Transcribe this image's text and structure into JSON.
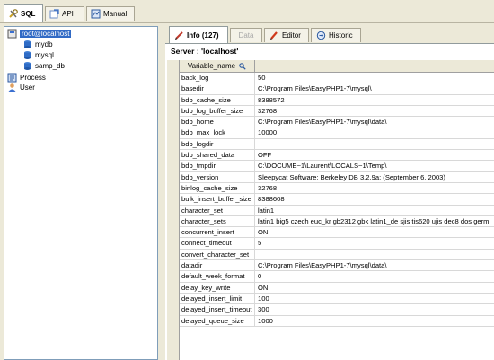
{
  "top_tabs": [
    {
      "label": "SQL",
      "icon": "sql-wrench-icon",
      "active": true
    },
    {
      "label": "API",
      "icon": "api-icon",
      "active": false
    },
    {
      "label": "Manual",
      "icon": "manual-icon",
      "active": false
    }
  ],
  "tree": {
    "root": "root@localhost",
    "databases": [
      "mydb",
      "mysql",
      "samp_db"
    ],
    "process": "Process",
    "user": "User"
  },
  "right_tabs": [
    {
      "label": "Info (127)",
      "icon": "info-icon",
      "state": "active"
    },
    {
      "label": "Data",
      "icon": "",
      "state": "disabled"
    },
    {
      "label": "Editor",
      "icon": "pencil-icon",
      "state": "normal"
    },
    {
      "label": "Historic",
      "icon": "historic-icon",
      "state": "normal"
    }
  ],
  "server_label": "Server : 'localhost'",
  "grid": {
    "column_header": "Variable_name",
    "rows": [
      {
        "name": "back_log",
        "value": "50"
      },
      {
        "name": "basedir",
        "value": "C:\\Program Files\\EasyPHP1-7\\mysql\\"
      },
      {
        "name": "bdb_cache_size",
        "value": "8388572"
      },
      {
        "name": "bdb_log_buffer_size",
        "value": "32768"
      },
      {
        "name": "bdb_home",
        "value": "C:\\Program Files\\EasyPHP1-7\\mysql\\data\\"
      },
      {
        "name": "bdb_max_lock",
        "value": "10000"
      },
      {
        "name": "bdb_logdir",
        "value": ""
      },
      {
        "name": "bdb_shared_data",
        "value": "OFF"
      },
      {
        "name": "bdb_tmpdir",
        "value": "C:\\DOCUME~1\\Laurent\\LOCALS~1\\Temp\\"
      },
      {
        "name": "bdb_version",
        "value": "Sleepycat Software: Berkeley DB 3.2.9a: (September  6, 2003)"
      },
      {
        "name": "binlog_cache_size",
        "value": "32768"
      },
      {
        "name": "bulk_insert_buffer_size",
        "value": "8388608"
      },
      {
        "name": "character_set",
        "value": "latin1"
      },
      {
        "name": "character_sets",
        "value": "latin1 big5 czech euc_kr gb2312 gbk latin1_de sjis tis620 ujis dec8 dos germ"
      },
      {
        "name": "concurrent_insert",
        "value": "ON"
      },
      {
        "name": "connect_timeout",
        "value": "5"
      },
      {
        "name": "convert_character_set",
        "value": ""
      },
      {
        "name": "datadir",
        "value": "C:\\Program Files\\EasyPHP1-7\\mysql\\data\\"
      },
      {
        "name": "default_week_format",
        "value": "0"
      },
      {
        "name": "delay_key_write",
        "value": "ON"
      },
      {
        "name": "delayed_insert_limit",
        "value": "100"
      },
      {
        "name": "delayed_insert_timeout",
        "value": "300"
      },
      {
        "name": "delayed_queue_size",
        "value": "1000"
      }
    ]
  }
}
